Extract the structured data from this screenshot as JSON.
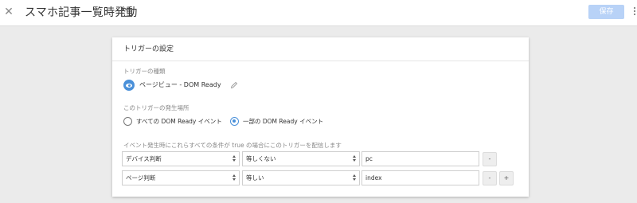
{
  "header": {
    "close_icon": "close-icon",
    "title": "スマホ記事一覧時発動",
    "folder_icon": "folder-icon",
    "save_label": "保存",
    "more_icon": "more-vertical-icon"
  },
  "card": {
    "heading": "トリガーの設定",
    "trigger_type_label": "トリガーの種類",
    "trigger_type_icon": "eye-icon",
    "trigger_type_value": "ページビュー - DOM Ready",
    "fire_on_label": "このトリガーの発生場所",
    "fire_on_options": [
      {
        "label": "すべての DOM Ready イベント",
        "selected": false
      },
      {
        "label": "一部の DOM Ready イベント",
        "selected": true
      }
    ],
    "conditions_label": "イベント発生時にこれらすべての条件が true の場合にこのトリガーを配信します",
    "conditions": [
      {
        "variable": "デバイス判断",
        "operator": "等しくない",
        "value": "pc",
        "remove_label": "-",
        "add_label": ""
      },
      {
        "variable": "ページ判断",
        "operator": "等しい",
        "value": "index",
        "remove_label": "-",
        "add_label": "+"
      }
    ]
  },
  "colors": {
    "accent": "#4a90d9",
    "save_button": "#b8d2f7",
    "background": "#ebebeb"
  }
}
